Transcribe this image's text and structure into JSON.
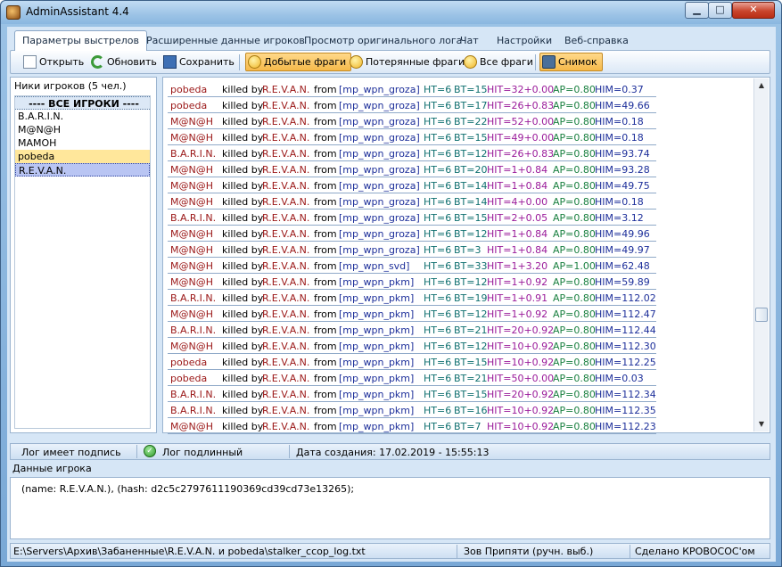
{
  "window": {
    "title": "AdminAssistant 4.4"
  },
  "tabs": [
    {
      "label": "Параметры выстрелов"
    },
    {
      "label": "Расширенные данные игроков"
    },
    {
      "label": "Просмотр оригинального лога"
    },
    {
      "label": "Чат"
    },
    {
      "label": "Настройки"
    },
    {
      "label": "Веб-справка"
    }
  ],
  "toolbar": {
    "open": "Открыть",
    "refresh": "Обновить",
    "save": "Сохранить",
    "kills": "Добытые фраги",
    "deaths": "Потерянные фраги",
    "all": "Все фраги",
    "snapshot": "Снимок"
  },
  "players": {
    "title": "Ники игроков (5 чел.)",
    "all_label": "---- ВСЕ ИГРОКИ ----",
    "items": [
      "B.A.R.I.N.",
      "M@N@H",
      "MAMOH",
      "pobeda",
      "R.E.V.A.N."
    ]
  },
  "log": {
    "rows": [
      [
        "pobeda",
        "killed by",
        "R.E.V.A.N.",
        "from",
        "[mp_wpn_groza]",
        "HT=6",
        "BT=15",
        "HIT=32+0.00",
        "AP=0.80",
        "HIM=0.37"
      ],
      [
        "pobeda",
        "killed by",
        "R.E.V.A.N.",
        "from",
        "[mp_wpn_groza]",
        "HT=6",
        "BT=17",
        "HIT=26+0.83",
        "AP=0.80",
        "HIM=49.66"
      ],
      [
        "M@N@H",
        "killed by",
        "R.E.V.A.N.",
        "from",
        "[mp_wpn_groza]",
        "HT=6",
        "BT=22",
        "HIT=52+0.00",
        "AP=0.80",
        "HIM=0.18"
      ],
      [
        "M@N@H",
        "killed by",
        "R.E.V.A.N.",
        "from",
        "[mp_wpn_groza]",
        "HT=6",
        "BT=15",
        "HIT=49+0.00",
        "AP=0.80",
        "HIM=0.18"
      ],
      [
        "B.A.R.I.N.",
        "killed by",
        "R.E.V.A.N.",
        "from",
        "[mp_wpn_groza]",
        "HT=6",
        "BT=12",
        "HIT=26+0.83",
        "AP=0.80",
        "HIM=93.74"
      ],
      [
        "M@N@H",
        "killed by",
        "R.E.V.A.N.",
        "from",
        "[mp_wpn_groza]",
        "HT=6",
        "BT=20",
        "HIT=1+0.84",
        "AP=0.80",
        "HIM=93.28"
      ],
      [
        "M@N@H",
        "killed by",
        "R.E.V.A.N.",
        "from",
        "[mp_wpn_groza]",
        "HT=6",
        "BT=14",
        "HIT=1+0.84",
        "AP=0.80",
        "HIM=49.75"
      ],
      [
        "M@N@H",
        "killed by",
        "R.E.V.A.N.",
        "from",
        "[mp_wpn_groza]",
        "HT=6",
        "BT=14",
        "HIT=4+0.00",
        "AP=0.80",
        "HIM=0.18"
      ],
      [
        "B.A.R.I.N.",
        "killed by",
        "R.E.V.A.N.",
        "from",
        "[mp_wpn_groza]",
        "HT=6",
        "BT=15",
        "HIT=2+0.05",
        "AP=0.80",
        "HIM=3.12"
      ],
      [
        "M@N@H",
        "killed by",
        "R.E.V.A.N.",
        "from",
        "[mp_wpn_groza]",
        "HT=6",
        "BT=12",
        "HIT=1+0.84",
        "AP=0.80",
        "HIM=49.96"
      ],
      [
        "M@N@H",
        "killed by",
        "R.E.V.A.N.",
        "from",
        "[mp_wpn_groza]",
        "HT=6",
        "BT=3",
        "HIT=1+0.84",
        "AP=0.80",
        "HIM=49.97"
      ],
      [
        "M@N@H",
        "killed by",
        "R.E.V.A.N.",
        "from",
        "[mp_wpn_svd]",
        "HT=6",
        "BT=33",
        "HIT=1+3.20",
        "AP=1.00",
        "HIM=62.48"
      ],
      [
        "M@N@H",
        "killed by",
        "R.E.V.A.N.",
        "from",
        "[mp_wpn_pkm]",
        "HT=6",
        "BT=12",
        "HIT=1+0.92",
        "AP=0.80",
        "HIM=59.89"
      ],
      [
        "B.A.R.I.N.",
        "killed by",
        "R.E.V.A.N.",
        "from",
        "[mp_wpn_pkm]",
        "HT=6",
        "BT=19",
        "HIT=1+0.91",
        "AP=0.80",
        "HIM=112.02"
      ],
      [
        "M@N@H",
        "killed by",
        "R.E.V.A.N.",
        "from",
        "[mp_wpn_pkm]",
        "HT=6",
        "BT=12",
        "HIT=1+0.92",
        "AP=0.80",
        "HIM=112.47"
      ],
      [
        "B.A.R.I.N.",
        "killed by",
        "R.E.V.A.N.",
        "from",
        "[mp_wpn_pkm]",
        "HT=6",
        "BT=21",
        "HIT=20+0.92",
        "AP=0.80",
        "HIM=112.44"
      ],
      [
        "M@N@H",
        "killed by",
        "R.E.V.A.N.",
        "from",
        "[mp_wpn_pkm]",
        "HT=6",
        "BT=12",
        "HIT=10+0.92",
        "AP=0.80",
        "HIM=112.30"
      ],
      [
        "pobeda",
        "killed by",
        "R.E.V.A.N.",
        "from",
        "[mp_wpn_pkm]",
        "HT=6",
        "BT=15",
        "HIT=10+0.92",
        "AP=0.80",
        "HIM=112.25"
      ],
      [
        "pobeda",
        "killed by",
        "R.E.V.A.N.",
        "from",
        "[mp_wpn_pkm]",
        "HT=6",
        "BT=21",
        "HIT=50+0.00",
        "AP=0.80",
        "HIM=0.03"
      ],
      [
        "B.A.R.I.N.",
        "killed by",
        "R.E.V.A.N.",
        "from",
        "[mp_wpn_pkm]",
        "HT=6",
        "BT=15",
        "HIT=20+0.92",
        "AP=0.80",
        "HIM=112.34"
      ],
      [
        "B.A.R.I.N.",
        "killed by",
        "R.E.V.A.N.",
        "from",
        "[mp_wpn_pkm]",
        "HT=6",
        "BT=16",
        "HIT=10+0.92",
        "AP=0.80",
        "HIM=112.35"
      ],
      [
        "M@N@H",
        "killed by",
        "R.E.V.A.N.",
        "from",
        "[mp_wpn_pkm]",
        "HT=6",
        "BT=7",
        "HIT=10+0.92",
        "AP=0.80",
        "HIM=112.23"
      ]
    ]
  },
  "status": {
    "signed": "Лог имеет подпись",
    "genuine": "Лог подлинный",
    "created": "Дата создания: 17.02.2019 - 15:55:13"
  },
  "player_data": {
    "label": "Данные игрока",
    "text": "(name: R.E.V.A.N.), (hash: d2c5c2797611190369cd39cd73e13265);"
  },
  "footer": {
    "path": "E:\\Servers\\Архив\\Забаненные\\R.E.V.A.N. и pobeda\\stalker_ccop_log.txt",
    "map": "Зов Припяти (ручн. выб.)",
    "credit": "Сделано КРОВОСОС'ом"
  }
}
